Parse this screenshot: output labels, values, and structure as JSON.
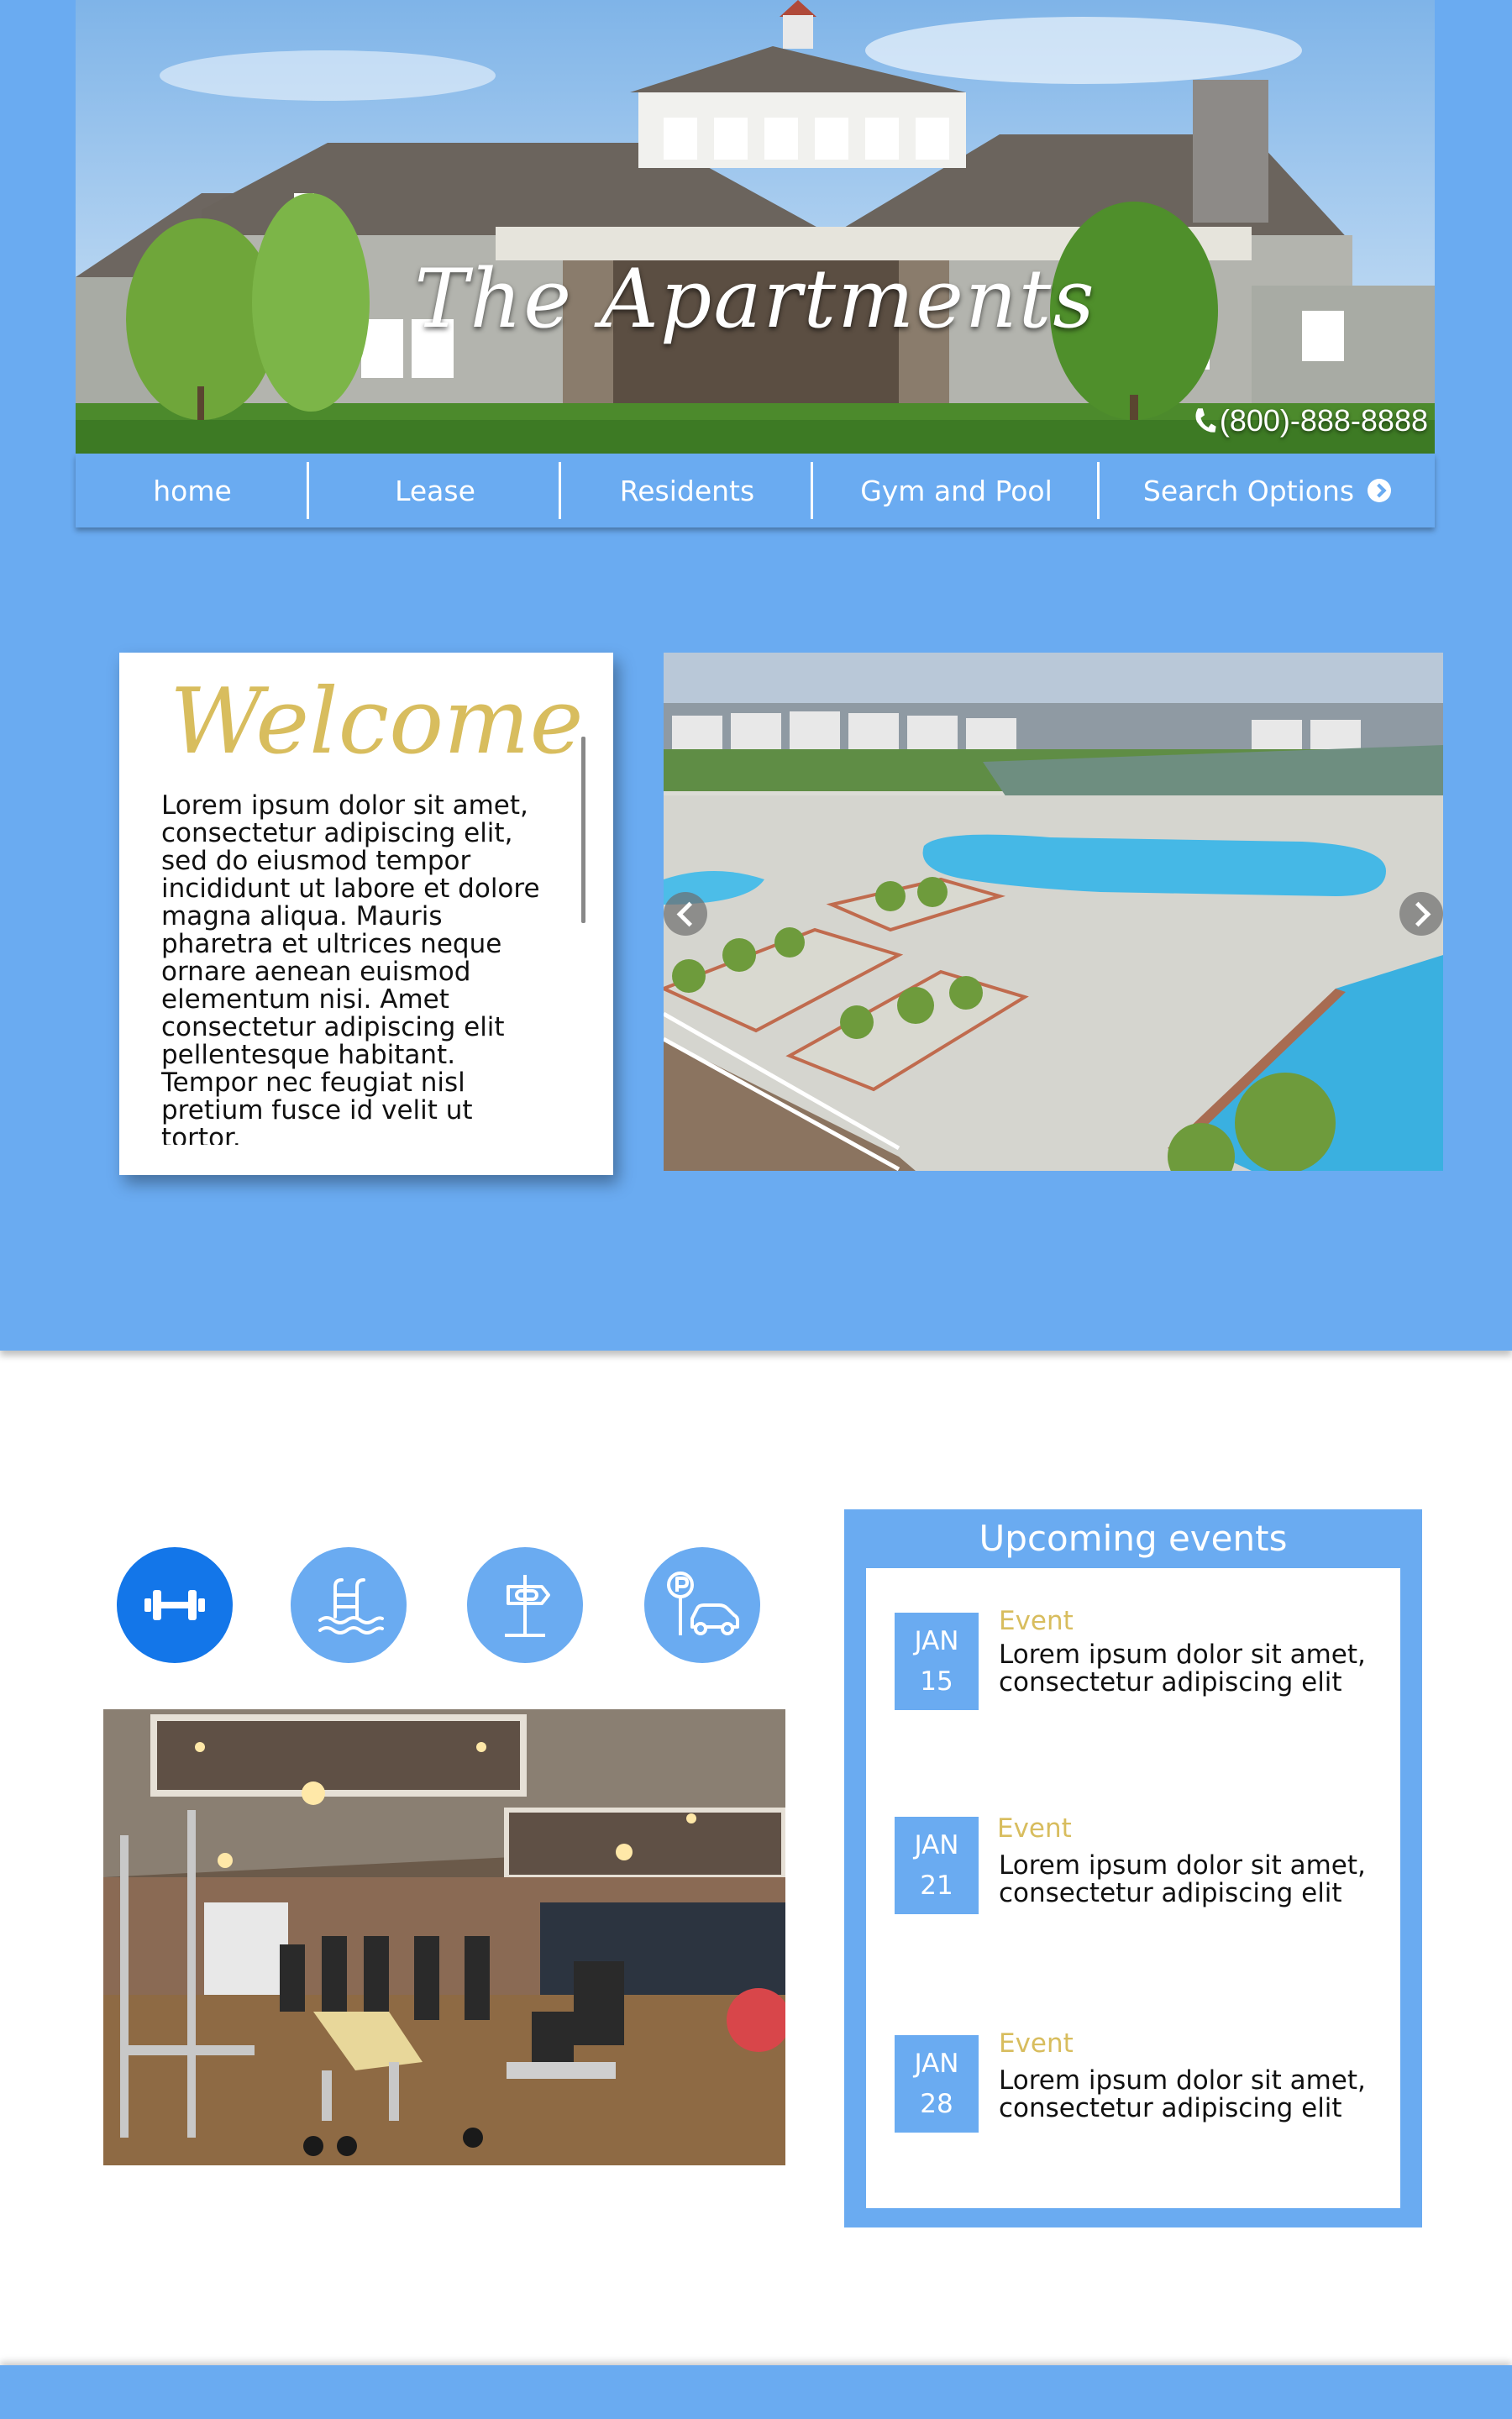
{
  "hero": {
    "title": "The Apartments",
    "phone": "(800)-888-8888"
  },
  "nav": {
    "items": [
      {
        "label": "home"
      },
      {
        "label": "Lease"
      },
      {
        "label": "Residents"
      },
      {
        "label": "Gym and Pool"
      },
      {
        "label": "Search Options"
      }
    ]
  },
  "welcome": {
    "title": "Welcome",
    "body": "Lorem ipsum dolor sit amet, consectetur adipiscing elit, sed do eiusmod tempor incididunt ut labore et dolore magna aliqua. Mauris pharetra et ultrices neque ornare aenean euismod elementum nisi. Amet consectetur adipiscing elit pellentesque habitant. Tempor nec feugiat nisl pretium fusce id velit ut tortor."
  },
  "amenities": [
    {
      "icon": "dumbbell-icon",
      "active": true
    },
    {
      "icon": "pool-icon",
      "active": false
    },
    {
      "icon": "dog-park-sign-icon",
      "active": false
    },
    {
      "icon": "parking-icon",
      "active": false
    }
  ],
  "events": {
    "title": "Upcoming events",
    "items": [
      {
        "month": "JAN",
        "day": "15",
        "name": "Event",
        "desc": "Lorem ipsum dolor sit amet, consectetur adipiscing elit"
      },
      {
        "month": "JAN",
        "day": "21",
        "name": "Event",
        "desc": "Lorem ipsum dolor sit amet, consectetur adipiscing elit"
      },
      {
        "month": "JAN",
        "day": "28",
        "name": "Event",
        "desc": "Lorem ipsum dolor sit amet, consectetur adipiscing elit"
      }
    ]
  },
  "colors": {
    "primary": "#6aabf1",
    "active": "#1376e9",
    "gold": "#d8bd5e"
  }
}
